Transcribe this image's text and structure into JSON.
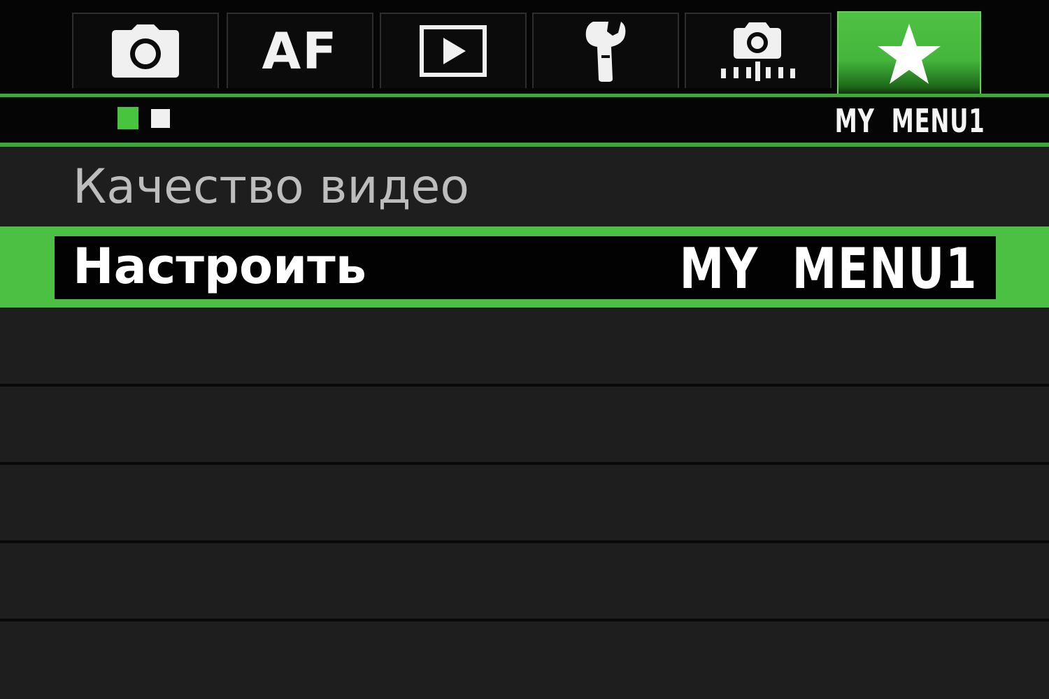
{
  "tabs": [
    {
      "id": "shooting",
      "icon": "camera-icon"
    },
    {
      "id": "af",
      "label": "AF"
    },
    {
      "id": "playback",
      "icon": "play-icon"
    },
    {
      "id": "setup",
      "icon": "wrench-icon"
    },
    {
      "id": "custom",
      "icon": "custom-functions-camera-icon"
    },
    {
      "id": "my-menu",
      "icon": "star-icon",
      "active": true
    }
  ],
  "header": {
    "menu_name": "MY  MENU1",
    "page_count": 2,
    "current_page": 1
  },
  "menu": {
    "items": [
      {
        "label": "Качество видео",
        "value": "",
        "selected": false
      },
      {
        "label": "Настроить",
        "value": "MY  MENU1",
        "selected": true
      }
    ],
    "empty_rows": 4
  },
  "colors": {
    "accent": "#4cc043",
    "background": "#1e1e1e",
    "header_bg": "#050505",
    "text_selected": "#ffffff",
    "text_normal": "#bdbdbd"
  }
}
